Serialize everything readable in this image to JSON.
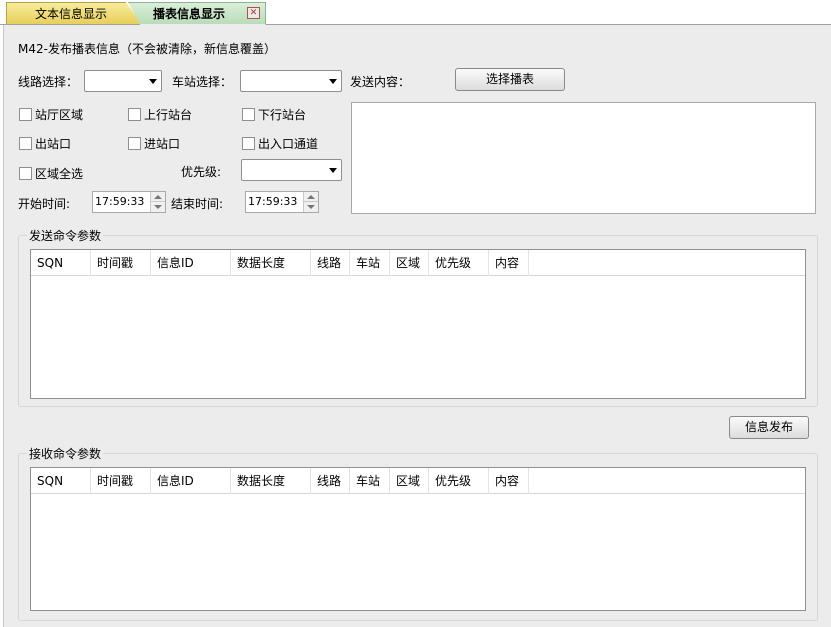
{
  "tabs": [
    {
      "label": "文本信息显示",
      "active": false
    },
    {
      "label": "播表信息显示",
      "active": true
    }
  ],
  "tab_close_symbol": "✕",
  "form": {
    "heading": "M42-发布播表信息（不会被清除，新信息覆盖）",
    "line_label": "线路选择：",
    "line_value": "",
    "station_label": "车站选择：",
    "station_value": "",
    "send_content_label": "发送内容：",
    "select_schedule_button": "选择播表",
    "send_content_value": "",
    "checkboxes": [
      {
        "label": "站厅区域",
        "checked": false
      },
      {
        "label": "上行站台",
        "checked": false
      },
      {
        "label": "下行站台",
        "checked": false
      },
      {
        "label": "出站口",
        "checked": false
      },
      {
        "label": "进站口",
        "checked": false
      },
      {
        "label": "出入口通道",
        "checked": false
      },
      {
        "label": "区域全选",
        "checked": false
      }
    ],
    "priority_label": "优先级:",
    "priority_value": "",
    "start_time_label": "开始时间:",
    "start_time_value": "17:59:33",
    "end_time_label": "结束时间:",
    "end_time_value": "17:59:33"
  },
  "send_group": {
    "title": "发送命令参数",
    "columns": [
      "SQN",
      "时间戳",
      "信息ID",
      "数据长度",
      "线路",
      "车站",
      "区域",
      "优先级",
      "内容"
    ],
    "rows": []
  },
  "publish_button": "信息发布",
  "receive_group": {
    "title": "接收命令参数",
    "columns": [
      "SQN",
      "时间戳",
      "信息ID",
      "数据长度",
      "线路",
      "车站",
      "区域",
      "优先级",
      "内容"
    ],
    "rows": []
  },
  "colors": {
    "panel_bg": "#ececec",
    "tab_inactive": "#e8cf5a",
    "tab_active": "#b9dcb9"
  }
}
